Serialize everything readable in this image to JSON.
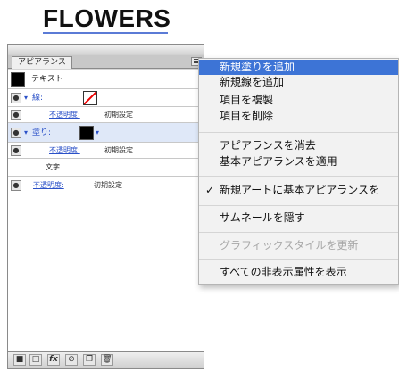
{
  "document": {
    "title": "FLOWERS"
  },
  "panel": {
    "tab_label": "アピアランス",
    "rows": {
      "object_label": "テキスト",
      "stroke_label": "線:",
      "stroke_opacity_label": "不透明度:",
      "stroke_opacity_value": "初期設定",
      "fill_label": "塗り:",
      "fill_opacity_label": "不透明度:",
      "fill_opacity_value": "初期設定",
      "characters_label": "文字",
      "object_opacity_label": "不透明度:",
      "object_opacity_value": "初期設定"
    },
    "bottom_icons": [
      "square-icon",
      "new-art-icon",
      "fx-icon",
      "clear-icon",
      "duplicate-icon",
      "trash-icon"
    ]
  },
  "menu": {
    "items": [
      {
        "label": "新規塗りを追加",
        "highlighted": true
      },
      {
        "label": "新規線を追加"
      },
      {
        "label": "項目を複製"
      },
      {
        "label": "項目を削除"
      },
      {
        "label": "アピアランスを消去"
      },
      {
        "label": "基本アピアランスを適用"
      },
      {
        "label": "新規アートに基本アピアランスを",
        "checked": true,
        "check_mark": "✓"
      },
      {
        "label": "サムネールを隠す"
      },
      {
        "label": "グラフィックスタイルを更新",
        "disabled": true
      },
      {
        "label": "すべての非表示属性を表示"
      }
    ]
  },
  "colors": {
    "highlight": "#3d74d6",
    "link": "#2b51c8"
  }
}
